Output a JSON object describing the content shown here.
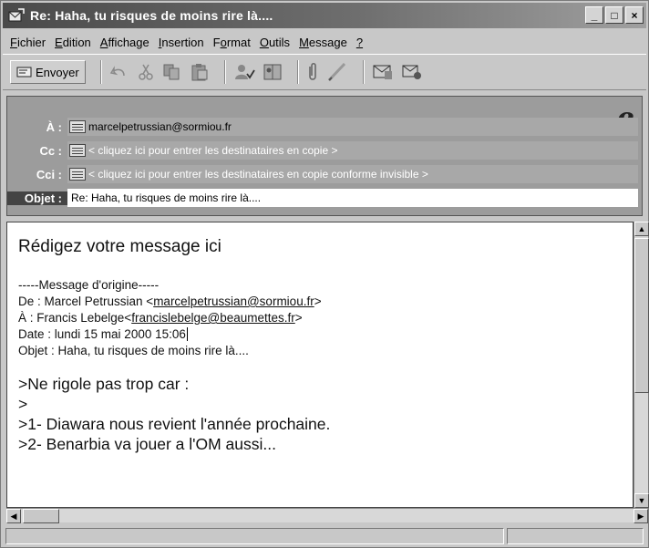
{
  "window": {
    "title": "Re: Haha, tu risques de moins rire là....",
    "buttons": {
      "minimize": "_",
      "maximize": "□",
      "close": "×"
    }
  },
  "menu": [
    {
      "pre": "",
      "u": "F",
      "post": "ichier"
    },
    {
      "pre": "",
      "u": "E",
      "post": "dition"
    },
    {
      "pre": "",
      "u": "A",
      "post": "ffichage"
    },
    {
      "pre": "",
      "u": "I",
      "post": "nsertion"
    },
    {
      "pre": "F",
      "u": "o",
      "post": "rmat"
    },
    {
      "pre": "",
      "u": "O",
      "post": "utils"
    },
    {
      "pre": "",
      "u": "M",
      "post": "essage"
    },
    {
      "pre": "",
      "u": "?",
      "post": ""
    }
  ],
  "toolbar": {
    "send_label": "Envoyer",
    "icons": [
      "undo-icon",
      "cut-icon",
      "copy-icon",
      "paste-icon",
      "check-names-icon",
      "address-book-icon",
      "attach-icon",
      "signature-icon",
      "insert-file-icon",
      "send-later-icon"
    ]
  },
  "header": {
    "to_label": "À :",
    "to_value": "marcelpetrussian@sormiou.fr",
    "cc_label": "Cc :",
    "cc_placeholder": "< cliquez ici pour entrer les destinataires en copie >",
    "bcc_label": "Cci :",
    "bcc_placeholder": "< cliquez ici pour entrer les destinataires en copie conforme invisible >",
    "subject_label": "Objet :",
    "subject_value": "Re: Haha, tu risques de moins rire là...."
  },
  "body": {
    "placeholder": "Rédigez votre message ici",
    "orig_header": "-----Message d'origine-----",
    "from_prefix": "De : Marcel Petrussian <",
    "from_email": "marcelpetrussian@sormiou.fr",
    "from_suffix": ">",
    "to_prefix": "À : Francis Lebelge<",
    "to_email": "francislebelge@beaumettes.fr",
    "to_suffix": ">",
    "date_line": "Date : lundi 15 mai 2000 15:06",
    "subject_line": "Objet : Haha, tu risques de moins rire là....",
    "quoted": [
      ">Ne rigole pas trop car :",
      ">",
      ">1- Diawara nous revient l'année prochaine.",
      ">2- Benarbia va jouer a l'OM aussi..."
    ]
  },
  "colors": {
    "title_gradient_start": "#4a4a4a",
    "header_bg": "#9c9c9c",
    "body_bg": "#ffffff"
  }
}
